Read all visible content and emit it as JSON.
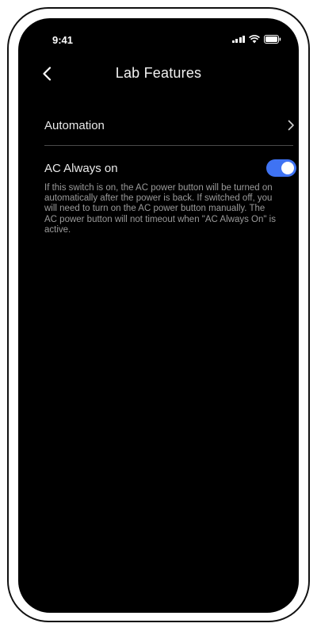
{
  "status_bar": {
    "time": "9:41",
    "icons": [
      "signal-icon",
      "wifi-icon",
      "battery-icon"
    ]
  },
  "header": {
    "title": "Lab Features",
    "back_icon": "chevron-left-icon"
  },
  "automation": {
    "label": "Automation",
    "chevron_icon": "chevron-right-icon"
  },
  "ac_always_on": {
    "label": "AC Always on",
    "enabled": true,
    "description": "If this switch is on, the AC power button will be turned on automatically after the power is back. If switched off, you will need to turn on the AC power button manually. The AC power button will not timeout when \"AC Always On\" is active."
  },
  "colors": {
    "background": "#000000",
    "toggle_on": "#3f73f3",
    "description_text": "#9a9a9a",
    "divider": "#4a4a4a"
  }
}
